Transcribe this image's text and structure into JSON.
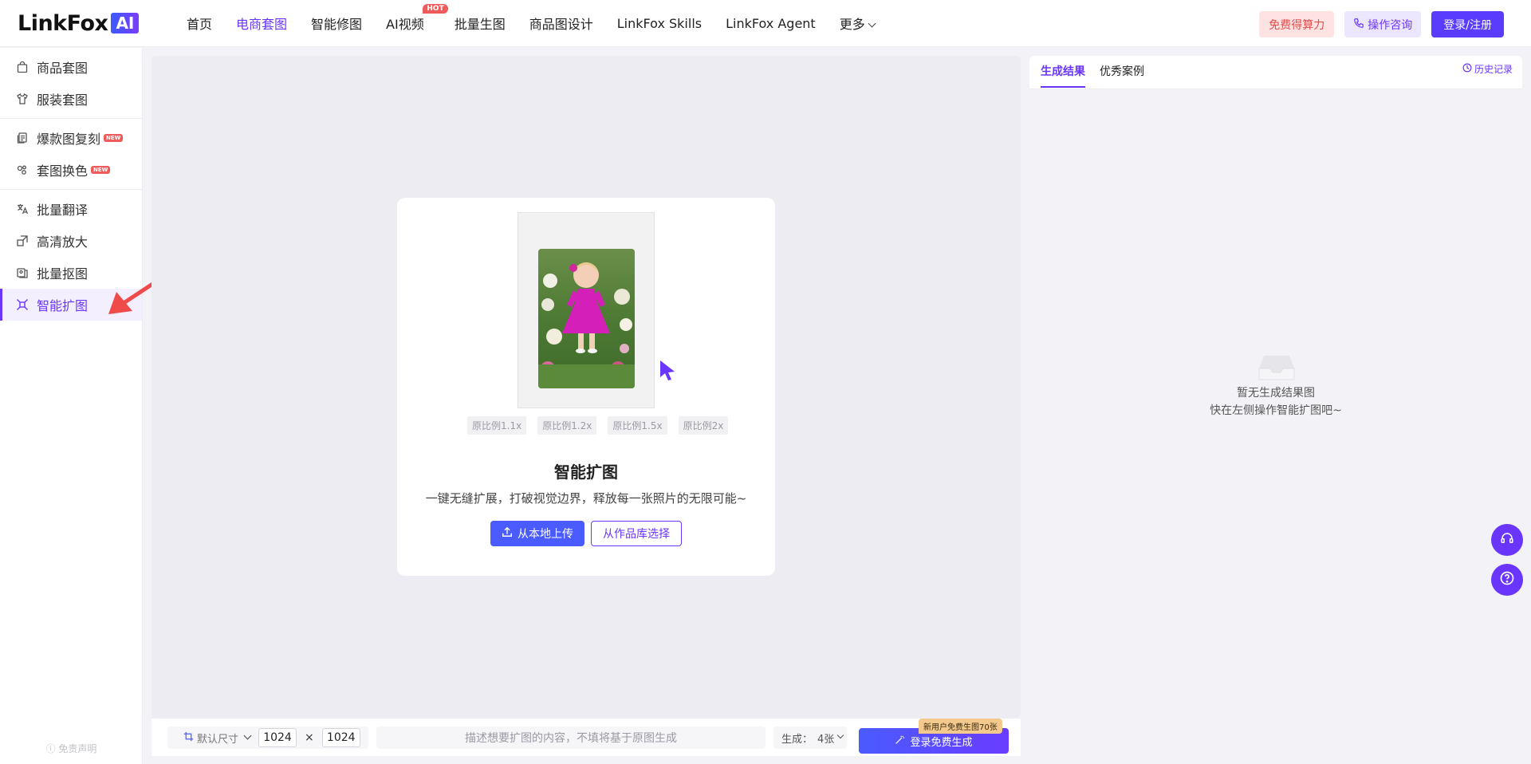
{
  "brand": {
    "name": "LinkFox",
    "ai_tag": "AI"
  },
  "nav": {
    "items": [
      {
        "label": "首页"
      },
      {
        "label": "电商套图"
      },
      {
        "label": "智能修图"
      },
      {
        "label": "AI视频",
        "badge": "HOT"
      },
      {
        "label": "批量生图"
      },
      {
        "label": "商品图设计"
      },
      {
        "label": "LinkFox Skills"
      },
      {
        "label": "LinkFox Agent"
      },
      {
        "label": "更多"
      }
    ],
    "active_index": 1
  },
  "top_actions": {
    "free_compute": "免费得算力",
    "consult": "操作咨询",
    "login": "登录/注册"
  },
  "sidebar": {
    "groups": [
      [
        {
          "label": "商品套图",
          "icon": "bag-icon"
        },
        {
          "label": "服装套图",
          "icon": "shirt-icon"
        }
      ],
      [
        {
          "label": "爆款图复刻",
          "icon": "copy-icon",
          "badge": "NEW"
        },
        {
          "label": "套图换色",
          "icon": "palette-icon",
          "badge": "NEW"
        }
      ],
      [
        {
          "label": "批量翻译",
          "icon": "translate-icon"
        },
        {
          "label": "高清放大",
          "icon": "upscale-icon"
        },
        {
          "label": "批量抠图",
          "icon": "cutout-icon"
        },
        {
          "label": "智能扩图",
          "icon": "expand-icon"
        }
      ]
    ],
    "active": "智能扩图",
    "disclaimer": "免责声明"
  },
  "main": {
    "ratios": [
      "原比例1.1x",
      "原比例1.2x",
      "原比例1.5x",
      "原比例2x"
    ],
    "title": "智能扩图",
    "subtitle": "一键无缝扩展，打破视觉边界，释放每一张照片的无限可能~",
    "upload_label": "从本地上传",
    "library_label": "从作品库选择"
  },
  "bottom": {
    "size_label": "默认尺寸",
    "width": "1024",
    "times": "×",
    "height": "1024",
    "prompt_placeholder": "描述想要扩图的内容，不填将基于原图生成",
    "gen_label": "生成：",
    "gen_count": "4张",
    "generate_label": "登录免费生成",
    "promo": "新用户免费生图70张"
  },
  "right_panel": {
    "tabs": [
      "生成结果",
      "优秀案例"
    ],
    "active_tab": 0,
    "history": "历史记录",
    "empty_line1": "暂无生成结果图",
    "empty_line2": "快在左侧操作智能扩图吧~"
  },
  "colors": {
    "accent": "#6a35ff",
    "primary_button": "#4a5bff",
    "hot": "#f05a5a"
  }
}
